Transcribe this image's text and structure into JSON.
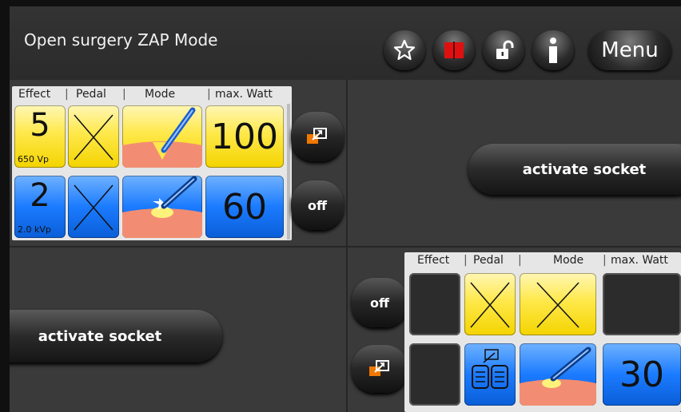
{
  "header": {
    "title": "Open surgery ZAP Mode",
    "menu_label": "Menu"
  },
  "icons": {
    "star": "star-icon",
    "book": "book-icon",
    "lock": "unlock-icon",
    "info": "info-icon"
  },
  "colors": {
    "yellow": "#ffe84a",
    "blue": "#1b7bff",
    "orange": "#f07800"
  },
  "top_left": {
    "headers": {
      "effect": "Effect",
      "pedal": "Pedal",
      "mode": "Mode",
      "watt": "max. Watt"
    },
    "row1": {
      "effect": "5",
      "effect_sub": "650 Vp",
      "watt": "100"
    },
    "row2": {
      "effect": "2",
      "effect_sub": "2.0 kVp",
      "watt": "60"
    },
    "off_label": "off"
  },
  "top_right": {
    "activate_label": "activate socket"
  },
  "bottom_left": {
    "activate_label": "activate socket"
  },
  "bottom_right": {
    "headers": {
      "effect": "Effect",
      "pedal": "Pedal",
      "mode": "Mode",
      "watt": "max. Watt"
    },
    "row2": {
      "watt": "30"
    },
    "off_label": "off"
  }
}
